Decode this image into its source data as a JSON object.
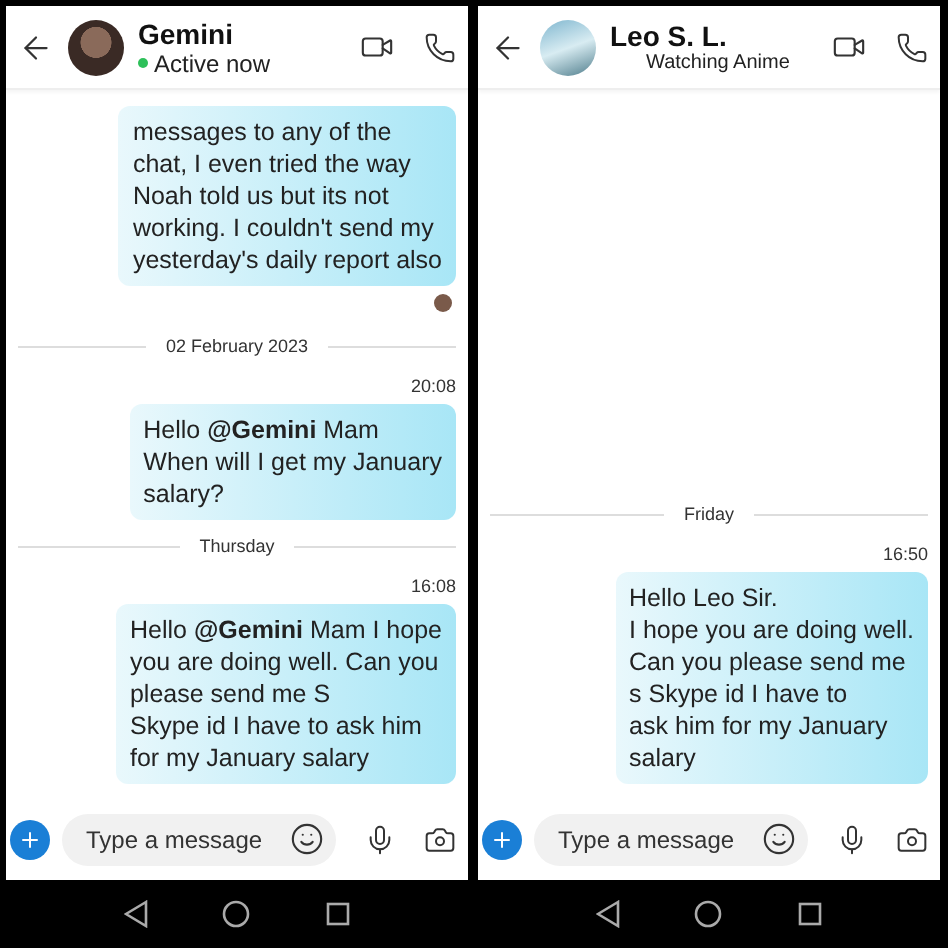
{
  "panels": [
    {
      "contact": {
        "name": "Gemini",
        "status": "Active now",
        "online": true
      },
      "items": [
        {
          "kind": "bubble",
          "lines": [
            "messages to any of the",
            "chat, I even tried the way",
            "Noah told us but its not",
            "working. I couldn't send my",
            "yesterday's daily report also"
          ]
        },
        {
          "kind": "seen"
        },
        {
          "kind": "divider",
          "text": "02 February 2023"
        },
        {
          "kind": "time",
          "text": "20:08"
        },
        {
          "kind": "bubble",
          "lines": [
            "Hello **@Gemini** Mam",
            "When will I get my January",
            "salary?"
          ]
        },
        {
          "kind": "divider",
          "text": "Thursday"
        },
        {
          "kind": "time",
          "text": "16:08"
        },
        {
          "kind": "bubble",
          "lines": [
            "Hello **@Gemini** Mam I hope",
            "you are doing well. Can you",
            "please send me S",
            "Skype id I have to ask him",
            "for my January salary"
          ]
        }
      ],
      "composer": {
        "placeholder": "Type a message"
      }
    },
    {
      "contact": {
        "name": "Leo S. L.",
        "status": "Watching Anime",
        "online": false
      },
      "items": [
        {
          "kind": "divider",
          "text": "Friday"
        },
        {
          "kind": "time",
          "text": "16:50"
        },
        {
          "kind": "bubble",
          "lines": [
            "Hello Leo Sir.",
            "I hope you are doing well.",
            "Can you please send me",
            "s Skype id I have to",
            "ask him for my January",
            "salary"
          ]
        }
      ],
      "composer": {
        "placeholder": "Type a message"
      }
    }
  ]
}
